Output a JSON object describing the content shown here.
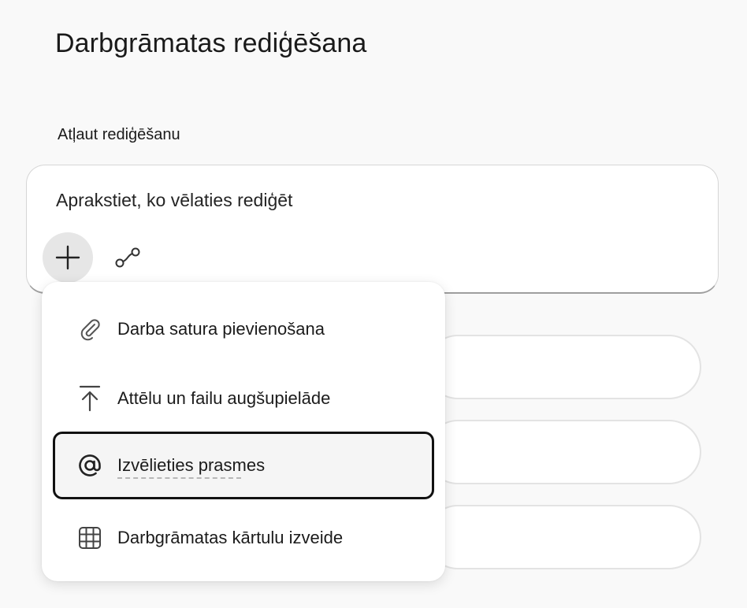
{
  "page": {
    "title": "Darbgrāmatas rediģēšana"
  },
  "section": {
    "label": "Atļaut rediģēšanu"
  },
  "prompt": {
    "placeholder": "Aprakstiet, ko vēlaties rediģēt",
    "add_icon": "plus-icon",
    "link_icon": "link-chain-icon"
  },
  "menu": {
    "items": [
      {
        "label": "Darba satura pievienošana",
        "icon": "paperclip-icon"
      },
      {
        "label": "Attēlu un failu augšupielāde",
        "icon": "upload-icon"
      },
      {
        "label": "Izvēlieties prasmes",
        "icon": "at-sign-icon",
        "selected": true
      },
      {
        "label": "Darbgrāmatas kārtulu izveide",
        "icon": "table-grid-icon"
      }
    ]
  }
}
